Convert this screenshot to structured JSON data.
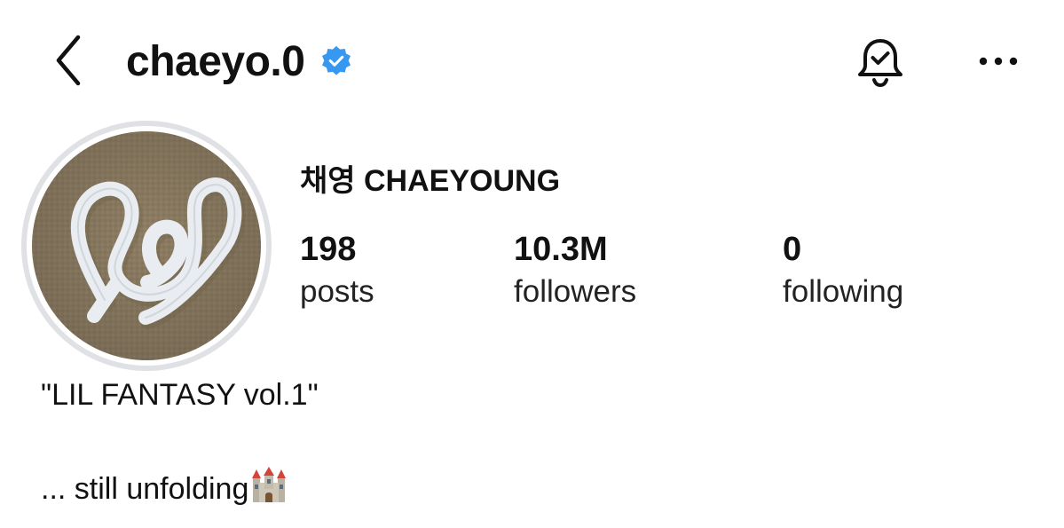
{
  "header": {
    "back_icon": "chevron-left-icon",
    "username": "chaeyo.0",
    "verified_icon": "verified-badge-icon",
    "verified_color": "#3897f0",
    "notification_icon": "bell-check-icon",
    "more_icon": "more-horizontal-icon"
  },
  "profile": {
    "display_name": "채영 CHAEYOUNG",
    "avatar_icon": "profile-avatar",
    "stats": {
      "posts": {
        "value": "198",
        "label": "posts"
      },
      "followers": {
        "value": "10.3M",
        "label": "followers"
      },
      "following": {
        "value": "0",
        "label": "following"
      }
    }
  },
  "bio": {
    "line1": "\"LIL FANTASY vol.1\"",
    "line2": "... still unfolding",
    "emoji_icon": "castle-icon"
  }
}
